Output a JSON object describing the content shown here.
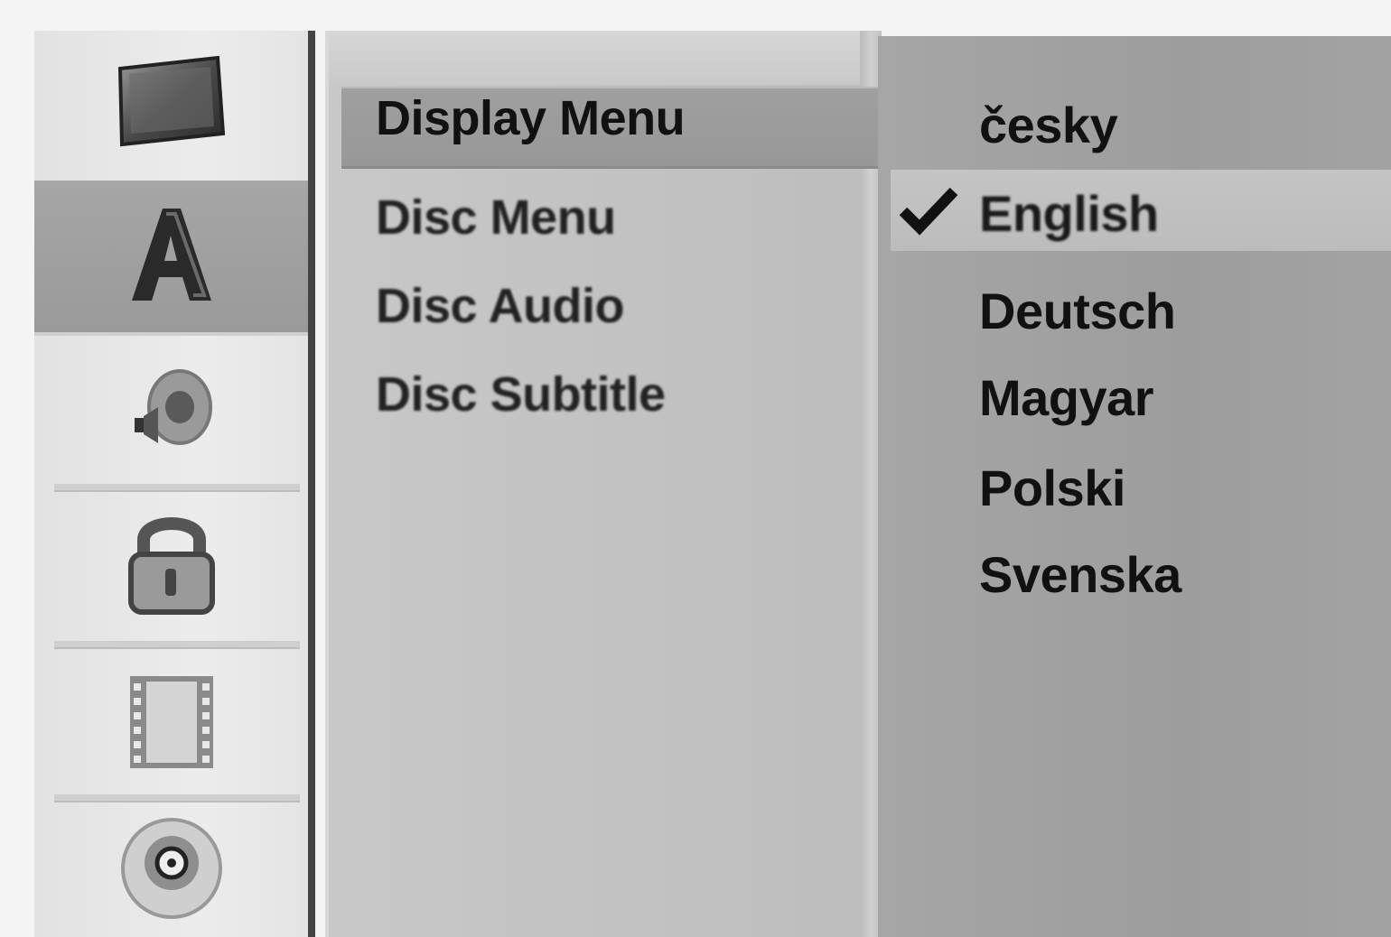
{
  "sidebar": {
    "icons": [
      {
        "name": "tv-screen-icon",
        "active": false
      },
      {
        "name": "language-icon",
        "active": true
      },
      {
        "name": "audio-speaker-icon",
        "active": false
      },
      {
        "name": "lock-icon",
        "active": false
      },
      {
        "name": "film-strip-icon",
        "active": false
      },
      {
        "name": "disc-icon",
        "active": false
      }
    ]
  },
  "menu": {
    "items": [
      {
        "label": "Display Menu",
        "selected": true
      },
      {
        "label": "Disc Menu",
        "selected": false
      },
      {
        "label": "Disc Audio",
        "selected": false
      },
      {
        "label": "Disc Subtitle",
        "selected": false
      }
    ]
  },
  "languages": {
    "items": [
      {
        "label": "česky",
        "checked": false
      },
      {
        "label": "English",
        "checked": true
      },
      {
        "label": "Deutsch",
        "checked": false
      },
      {
        "label": "Magyar",
        "checked": false
      },
      {
        "label": "Polski",
        "checked": false
      },
      {
        "label": "Svenska",
        "checked": false
      }
    ]
  },
  "colors": {
    "selected_highlight": "#9f9f9f",
    "panel_bg": "#bdbdbd",
    "language_panel_bg": "#a3a3a3"
  }
}
